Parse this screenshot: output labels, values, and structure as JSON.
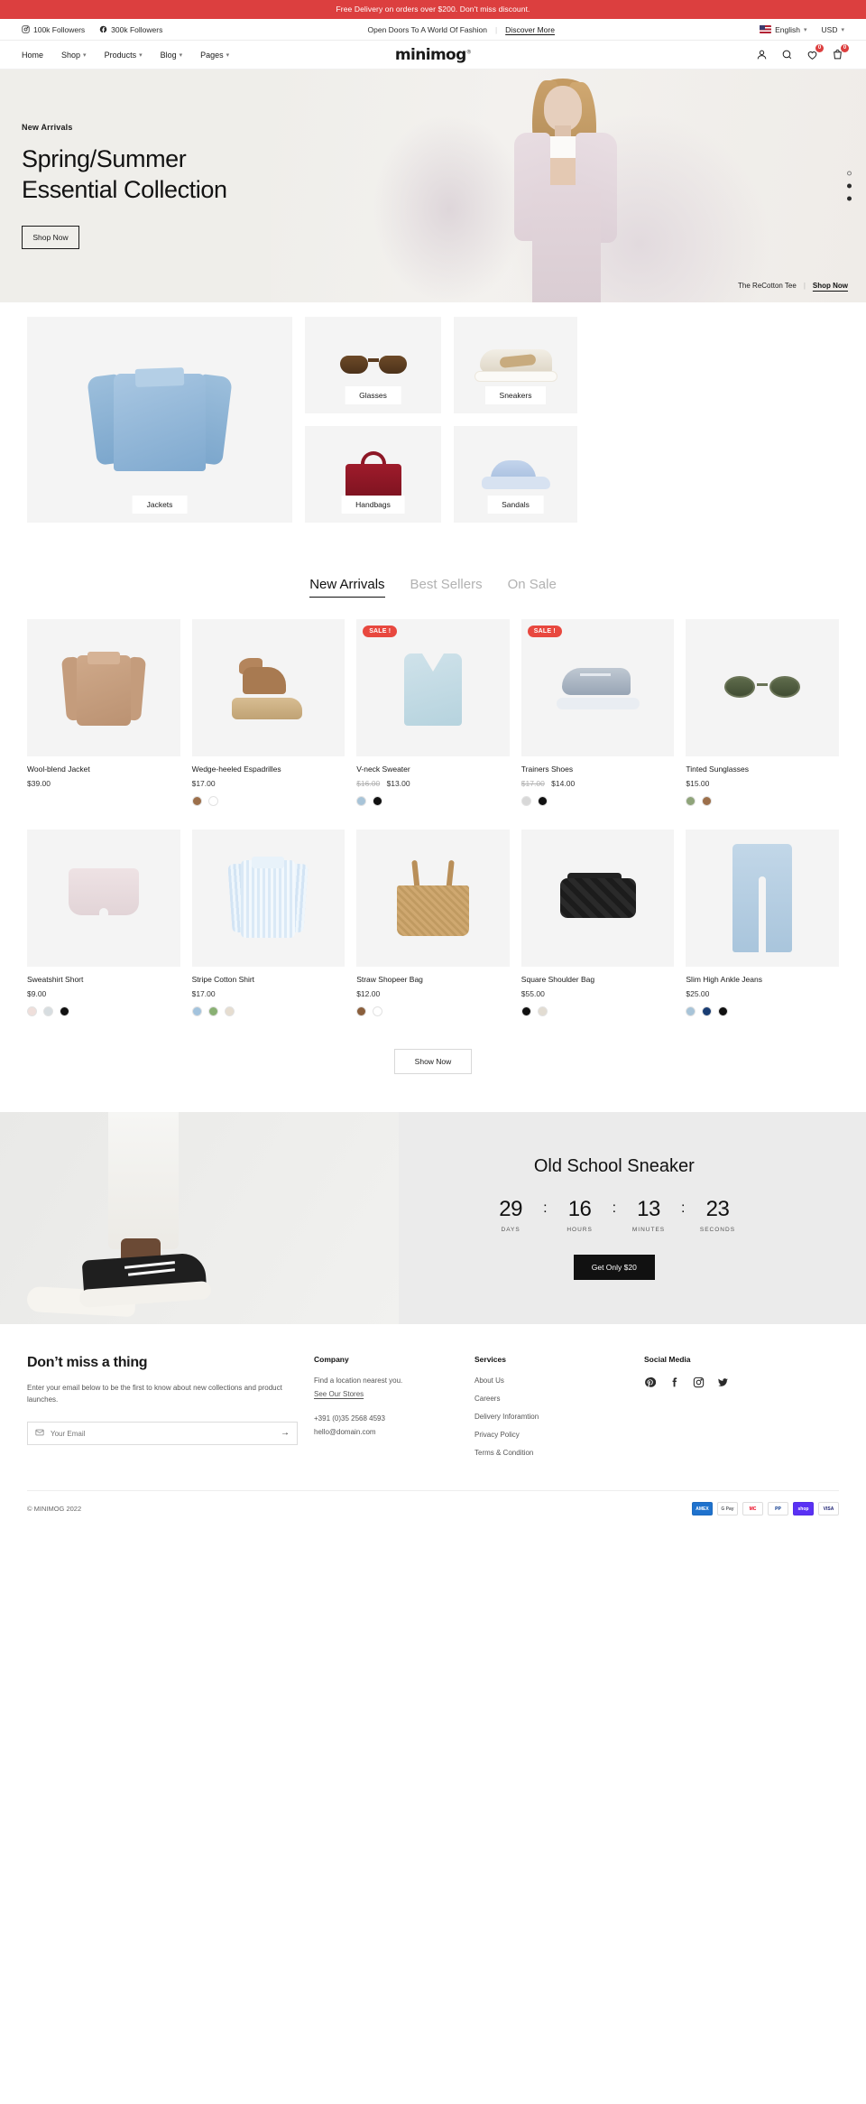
{
  "announcement": {
    "text": "Free Delivery on orders over $200. Don't miss discount."
  },
  "topbar": {
    "instagram_followers": "100k Followers",
    "facebook_followers": "300k Followers",
    "tagline": "Open Doors To A World Of Fashion",
    "discover_link": "Discover More",
    "language": "English",
    "currency": "USD"
  },
  "nav": {
    "logo": "minimog",
    "logo_mark": "®",
    "items": [
      {
        "label": "Home",
        "has_caret": false
      },
      {
        "label": "Shop",
        "has_caret": true
      },
      {
        "label": "Products",
        "has_caret": true
      },
      {
        "label": "Blog",
        "has_caret": true
      },
      {
        "label": "Pages",
        "has_caret": true
      }
    ],
    "wishlist_count": "0",
    "cart_count": "0"
  },
  "hero": {
    "eyebrow": "New Arrivals",
    "title_line1": "Spring/Summer",
    "title_line2": "Essential Collection",
    "button": "Shop Now",
    "footer_label": "The ReCotton Tee",
    "footer_link": "Shop Now"
  },
  "categories": [
    {
      "name": "Jackets",
      "art": "jacket"
    },
    {
      "name": "Glasses",
      "art": "glasses"
    },
    {
      "name": "Sneakers",
      "art": "sneaker"
    },
    {
      "name": "Handbags",
      "art": "handbag"
    },
    {
      "name": "Sandals",
      "art": "sandal"
    }
  ],
  "tabs": [
    {
      "label": "New Arrivals",
      "active": true
    },
    {
      "label": "Best Sellers",
      "active": false
    },
    {
      "label": "On Sale",
      "active": false
    }
  ],
  "products_row1": [
    {
      "title": "Wool-blend Jacket",
      "price": "$39.00",
      "old_price": "",
      "badge": "",
      "swatches": []
    },
    {
      "title": "Wedge-heeled Espadrilles",
      "price": "$17.00",
      "old_price": "",
      "badge": "",
      "swatches": [
        "#9c6f4a",
        "#ffffff"
      ]
    },
    {
      "title": "V-neck Sweater",
      "price": "$13.00",
      "old_price": "$16.00",
      "badge": "SALE !",
      "swatches": [
        "#a8c4d8",
        "#111111"
      ]
    },
    {
      "title": "Trainers Shoes",
      "price": "$14.00",
      "old_price": "$17.00",
      "badge": "SALE !",
      "swatches": [
        "#d8d8d8",
        "#111111"
      ]
    },
    {
      "title": "Tinted Sunglasses",
      "price": "$15.00",
      "old_price": "",
      "badge": "",
      "swatches": [
        "#8fa47a",
        "#9c6f4a"
      ]
    }
  ],
  "products_row2": [
    {
      "title": "Sweatshirt Short",
      "price": "$9.00",
      "old_price": "",
      "badge": "",
      "swatches": [
        "#efdfdb",
        "#d7dde0",
        "#111111"
      ]
    },
    {
      "title": "Stripe Cotton Shirt",
      "price": "$17.00",
      "old_price": "",
      "badge": "",
      "swatches": [
        "#a3c3dd",
        "#89b073",
        "#e6ddd0"
      ]
    },
    {
      "title": "Straw Shopeer Bag",
      "price": "$12.00",
      "old_price": "",
      "badge": "",
      "swatches": [
        "#8a5f3c",
        "#ffffff"
      ]
    },
    {
      "title": "Square Shoulder Bag",
      "price": "$55.00",
      "old_price": "",
      "badge": "",
      "swatches": [
        "#111111",
        "#e2dcd2"
      ]
    },
    {
      "title": "Slim High Ankle Jeans",
      "price": "$25.00",
      "old_price": "",
      "badge": "",
      "swatches": [
        "#a8c4d8",
        "#1a3d73",
        "#111111"
      ]
    }
  ],
  "show_more": "Show Now",
  "banner": {
    "title": "Old School Sneaker",
    "countdown": [
      {
        "value": "29",
        "label": "DAYS"
      },
      {
        "value": "16",
        "label": "HOURS"
      },
      {
        "value": "13",
        "label": "MINUTES"
      },
      {
        "value": "23",
        "label": "SECONDS"
      }
    ],
    "separator": ":",
    "button": "Get Only $20"
  },
  "footer": {
    "newsletter": {
      "title": "Don’t miss a thing",
      "description": "Enter your email below to be the first to know about new collections and product launches.",
      "placeholder": "Your Email",
      "value": "",
      "submit": "→"
    },
    "company": {
      "heading": "Company",
      "location_text": "Find a location nearest you.",
      "stores_link": "See Our Stores",
      "phone": "+391 (0)35 2568 4593",
      "email": "hello@domain.com"
    },
    "services": {
      "heading": "Services",
      "links": [
        "About Us",
        "Careers",
        "Delivery Inforamtion",
        "Privacy Policy",
        "Terms & Condition"
      ]
    },
    "social": {
      "heading": "Social Media",
      "icons": [
        "pinterest-icon",
        "facebook-icon",
        "instagram-icon",
        "twitter-icon"
      ]
    },
    "copyright": "© MINIMOG 2022",
    "payments": [
      {
        "name": "AMEX",
        "label": "AMEX",
        "color": "#1f72cd"
      },
      {
        "name": "GPay",
        "label": "G Pay",
        "color": "#ffffff"
      },
      {
        "name": "Mastercard",
        "label": "MC",
        "color": "#ffffff"
      },
      {
        "name": "PayPal",
        "label": "PP",
        "color": "#ffffff"
      },
      {
        "name": "Shop Pay",
        "label": "shop",
        "color": "#5a31f4"
      },
      {
        "name": "Visa",
        "label": "VISA",
        "color": "#ffffff"
      }
    ]
  },
  "colors": {
    "accent": "#dc3f3f",
    "sale": "#e8483f",
    "dark": "#111111"
  }
}
